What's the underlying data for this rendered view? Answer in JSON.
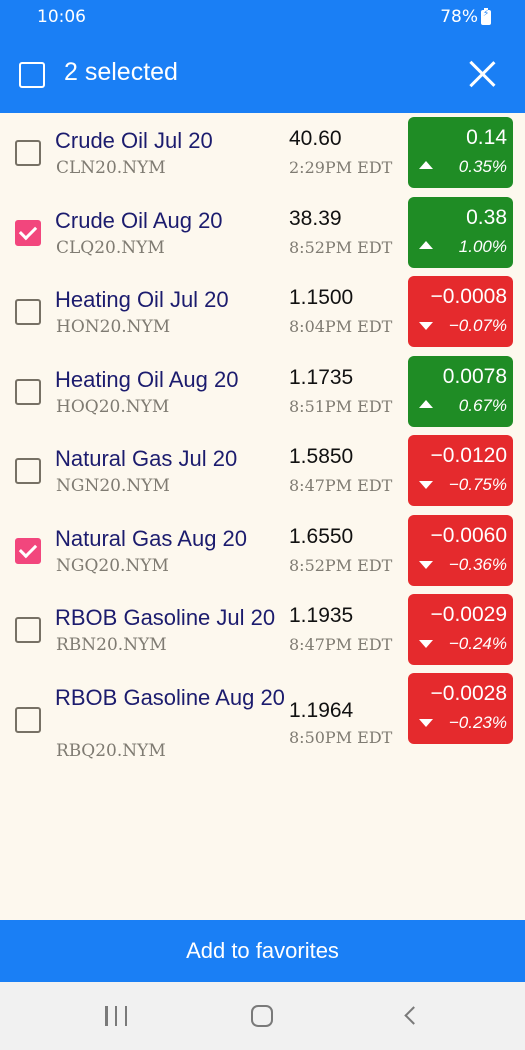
{
  "status_bar": {
    "time": "10:06",
    "battery": "78%"
  },
  "app_bar": {
    "selected_label": "2 selected",
    "select_all_checked": false
  },
  "items": [
    {
      "name": "Crude Oil Jul 20",
      "symbol": "CLN20.NYM",
      "price": "40.60",
      "time": "2:29PM EDT",
      "change": "0.14",
      "percent": "0.35%",
      "direction": "up",
      "checked": false
    },
    {
      "name": "Crude Oil Aug 20",
      "symbol": "CLQ20.NYM",
      "price": "38.39",
      "time": "8:52PM EDT",
      "change": "0.38",
      "percent": "1.00%",
      "direction": "up",
      "checked": true
    },
    {
      "name": "Heating Oil Jul 20",
      "symbol": "HON20.NYM",
      "price": "1.1500",
      "time": "8:04PM EDT",
      "change": "-0.0008",
      "percent": "-0.07%",
      "direction": "down",
      "checked": false
    },
    {
      "name": "Heating Oil Aug 20",
      "symbol": "HOQ20.NYM",
      "price": "1.1735",
      "time": "8:51PM EDT",
      "change": "0.0078",
      "percent": "0.67%",
      "direction": "up",
      "checked": false
    },
    {
      "name": "Natural Gas Jul 20",
      "symbol": "NGN20.NYM",
      "price": "1.5850",
      "time": "8:47PM EDT",
      "change": "-0.0120",
      "percent": "-0.75%",
      "direction": "down",
      "checked": false
    },
    {
      "name": "Natural Gas Aug 20",
      "symbol": "NGQ20.NYM",
      "price": "1.6550",
      "time": "8:52PM EDT",
      "change": "-0.0060",
      "percent": "-0.36%",
      "direction": "down",
      "checked": true
    },
    {
      "name": "RBOB Gasoline Jul 20",
      "symbol": "RBN20.NYM",
      "price": "1.1935",
      "time": "8:47PM EDT",
      "change": "-0.0029",
      "percent": "-0.24%",
      "direction": "down",
      "checked": false
    },
    {
      "name": "RBOB Gasoline Aug 20",
      "symbol": "RBQ20.NYM",
      "price": "1.1964",
      "time": "8:50PM EDT",
      "change": "-0.0028",
      "percent": "-0.23%",
      "direction": "down",
      "checked": false
    }
  ],
  "actions": {
    "add_favorites": "Add to favorites"
  },
  "colors": {
    "primary": "#1a7ff5",
    "up": "#1f8c25",
    "down": "#e52a2d",
    "checkbox_checked": "#f2467d",
    "name_text": "#1c1c6e"
  },
  "icons": {
    "battery": "battery-charging-icon",
    "close": "close-icon",
    "up": "triangle-up-icon",
    "down": "triangle-down-icon"
  }
}
